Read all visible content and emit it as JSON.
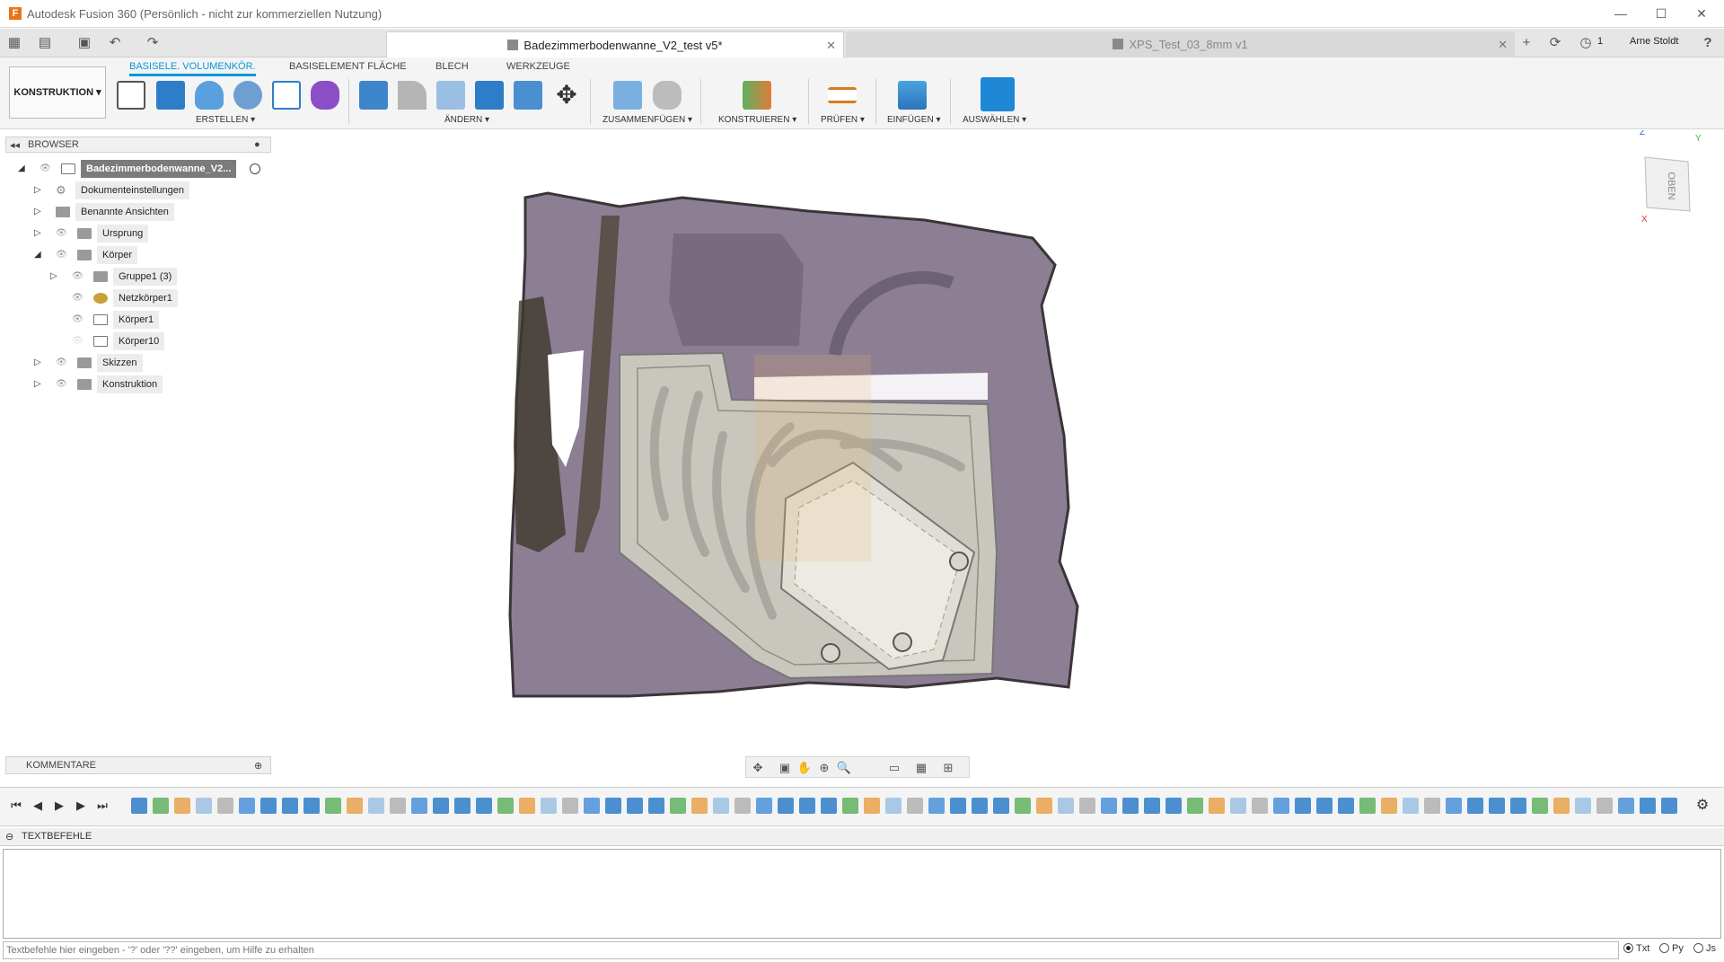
{
  "window": {
    "title": "Autodesk Fusion 360 (Persönlich - nicht zur kommerziellen Nutzung)",
    "app_icon": "F",
    "controls": [
      "—",
      "☐",
      "✕"
    ]
  },
  "tabbar": {
    "active_tab": "Badezimmerbodenwanne_V2_test v5*",
    "inactive_tab": "XPS_Test_03_8mm v1",
    "job_count": "1",
    "user": "Arne Stoldt",
    "help": "?"
  },
  "toolbar": {
    "workspace": "KONSTRUKTION ▾",
    "tabs": [
      "BASISELE. VOLUMENKÖR.",
      "BASISELEMENT FLÄCHE",
      "BLECH",
      "WERKZEUGE"
    ],
    "groups": [
      "ERSTELLEN ▾",
      "ÄNDERN ▾",
      "ZUSAMMENFÜGEN ▾",
      "KONSTRUIEREN ▾",
      "PRÜFEN ▾",
      "EINFÜGEN ▾",
      "AUSWÄHLEN ▾"
    ]
  },
  "browser": {
    "header": "BROWSER",
    "items": [
      {
        "label": "Badezimmerbodenwanne_V2..."
      },
      {
        "label": "Dokumenteinstellungen"
      },
      {
        "label": "Benannte Ansichten"
      },
      {
        "label": "Ursprung"
      },
      {
        "label": "Körper"
      },
      {
        "label": "Gruppe1 (3)"
      },
      {
        "label": "Netzkörper1"
      },
      {
        "label": "Körper1"
      },
      {
        "label": "Körper10"
      },
      {
        "label": "Skizzen"
      },
      {
        "label": "Konstruktion"
      }
    ]
  },
  "viewcube": {
    "face": "OBEN",
    "axis_z": "Z",
    "axis_y": "Y",
    "axis_x": "X"
  },
  "comments": {
    "label": "KOMMENTARE"
  },
  "textcommands": {
    "header": "TEXTBEFEHLE",
    "placeholder": "Textbefehle hier eingeben - '?' oder '??' eingeben, um Hilfe zu erhalten",
    "modes": [
      "Txt",
      "Py",
      "Js"
    ]
  },
  "colors": {
    "accent": "#0696d7",
    "mesh": "#8d7f93",
    "model": "#c9c7bd",
    "select": "#1e88d6"
  }
}
